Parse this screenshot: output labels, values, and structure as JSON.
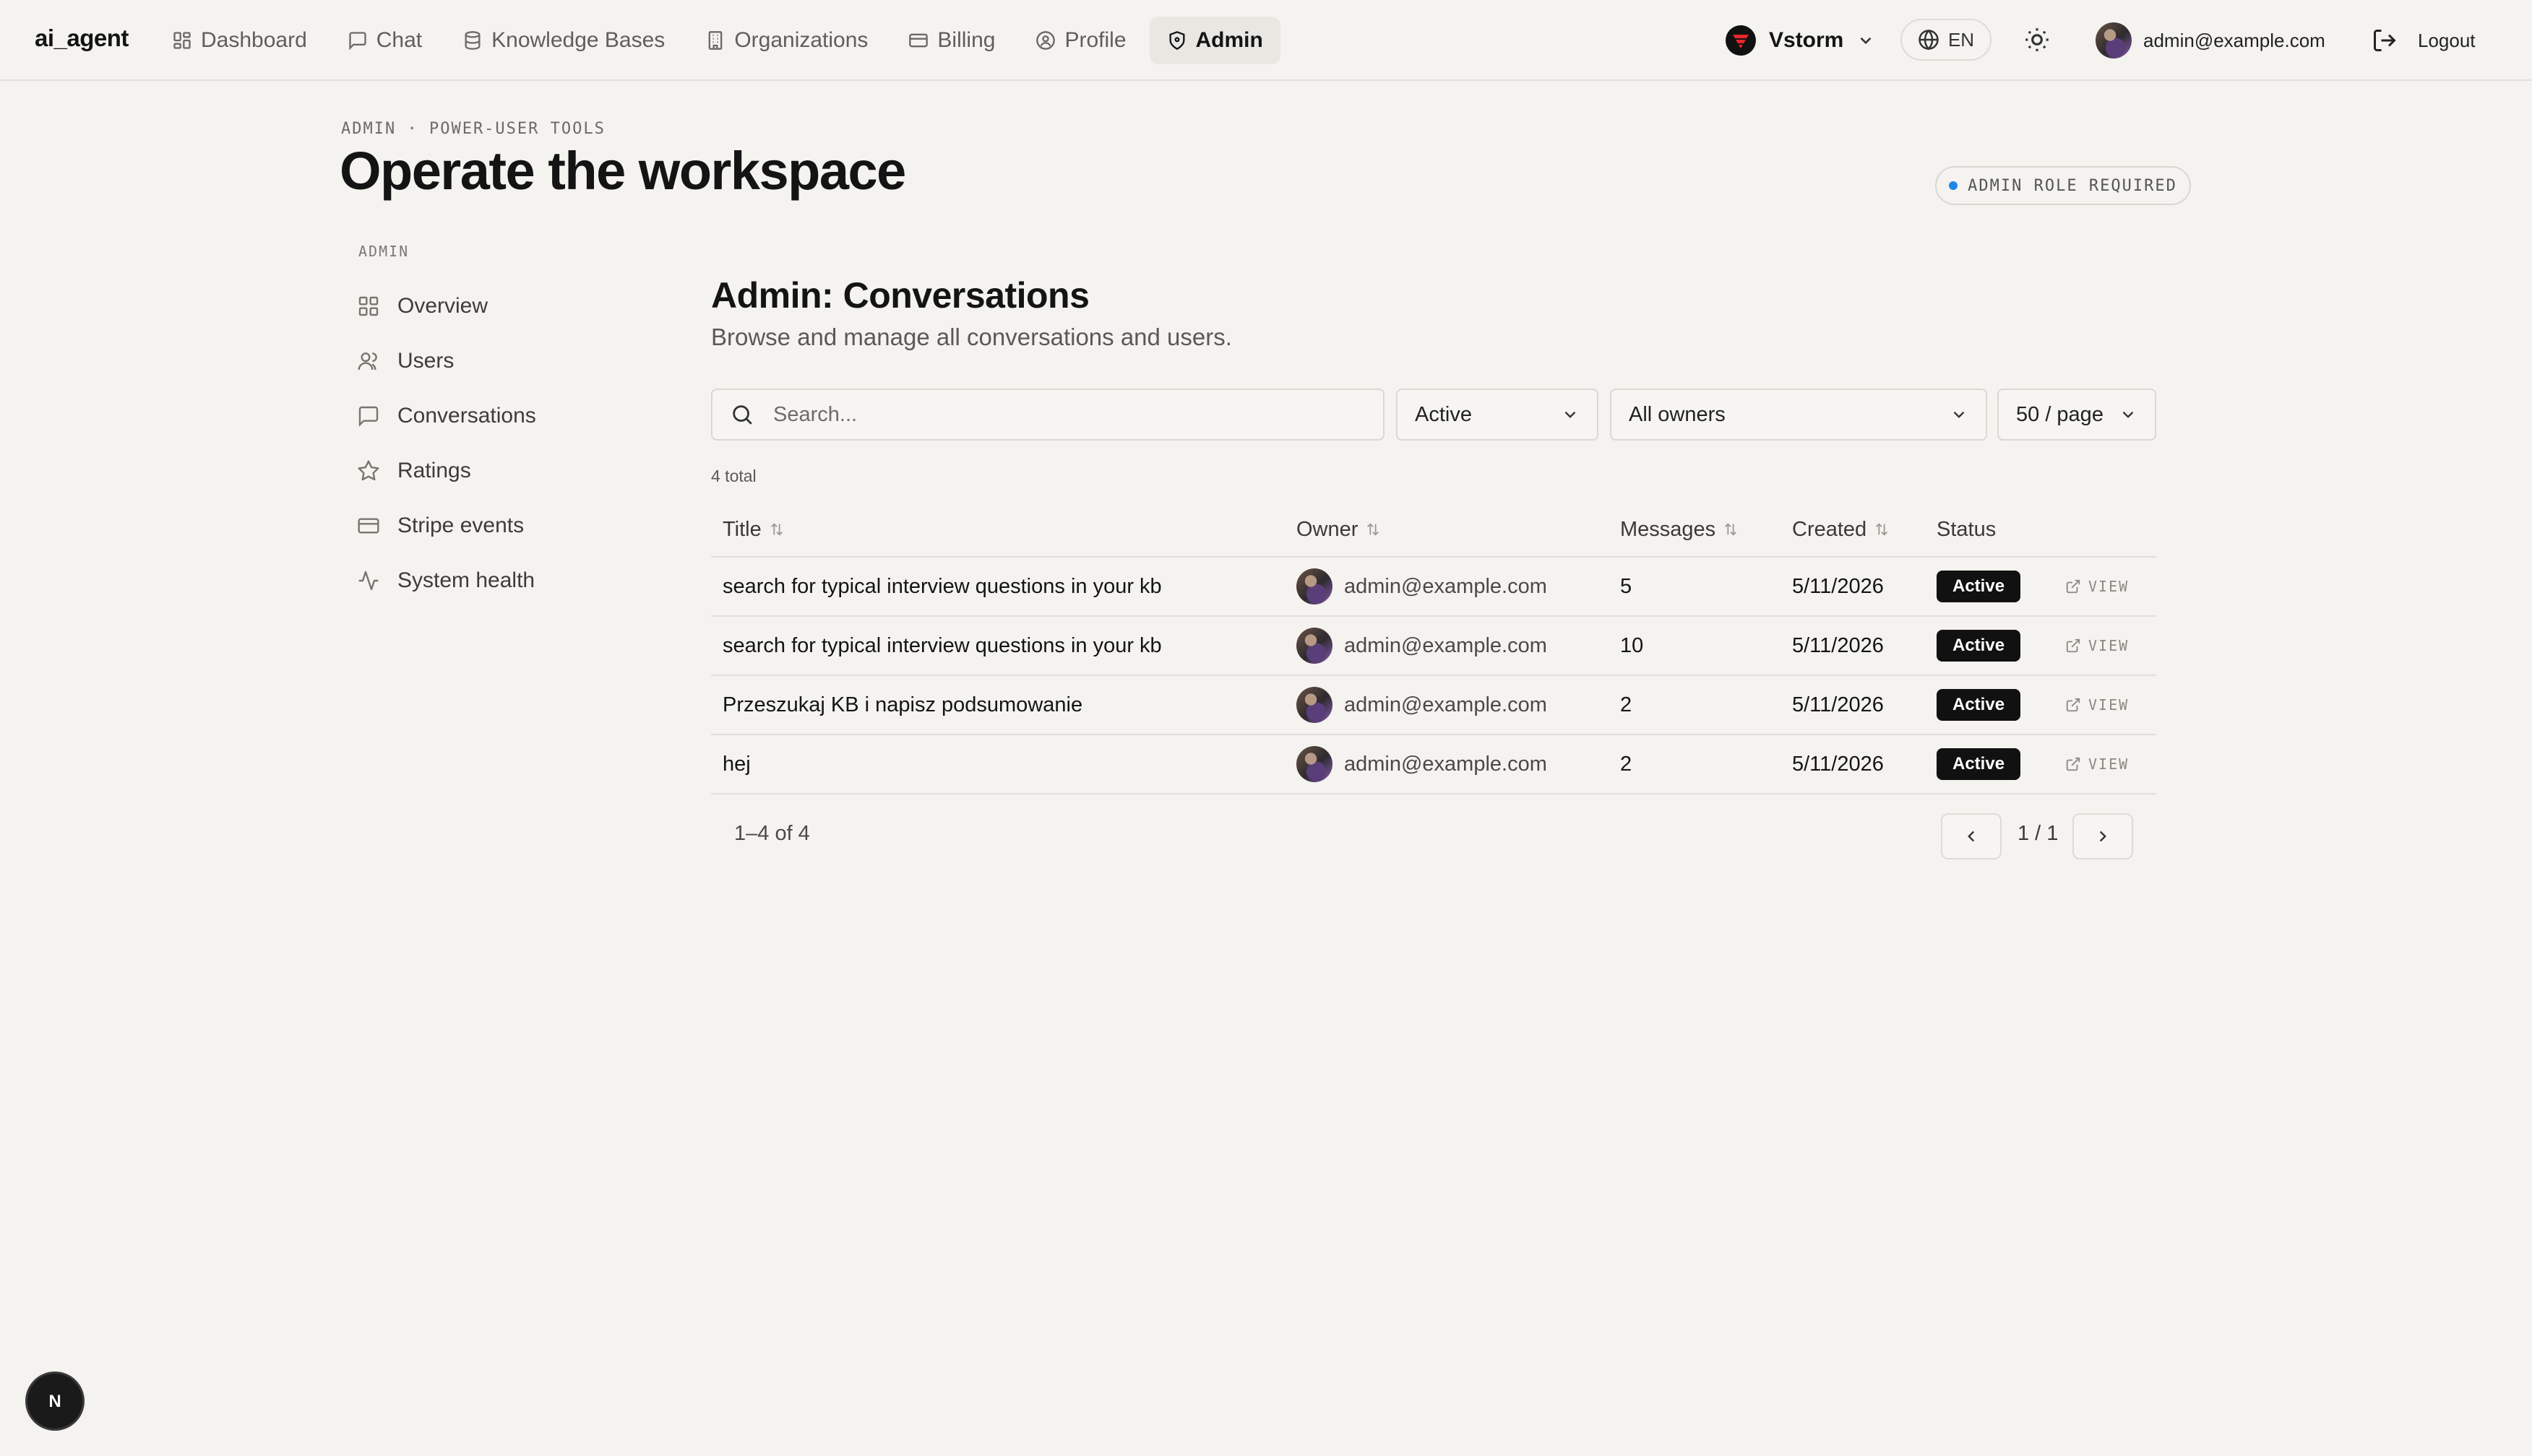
{
  "app": {
    "brand": "ai_agent"
  },
  "nav": [
    {
      "label": "Dashboard",
      "icon": "grid-icon"
    },
    {
      "label": "Chat",
      "icon": "chat-icon"
    },
    {
      "label": "Knowledge Bases",
      "icon": "database-icon"
    },
    {
      "label": "Organizations",
      "icon": "building-icon"
    },
    {
      "label": "Billing",
      "icon": "card-icon"
    },
    {
      "label": "Profile",
      "icon": "user-circle-icon"
    },
    {
      "label": "Admin",
      "icon": "shield-icon",
      "active": true
    }
  ],
  "org": {
    "name": "Vstorm",
    "logo_color": "#e8262d"
  },
  "lang": {
    "code": "EN"
  },
  "user": {
    "email": "admin@example.com"
  },
  "logout": {
    "label": "Logout"
  },
  "header": {
    "eyebrow": "ADMIN · POWER-USER TOOLS",
    "title": "Operate the workspace",
    "role_badge": "ADMIN ROLE REQUIRED",
    "role_dot_color": "#1f87e8"
  },
  "sidebar": {
    "label": "ADMIN",
    "items": [
      {
        "label": "Overview",
        "icon": "dashboard-icon"
      },
      {
        "label": "Users",
        "icon": "users-icon"
      },
      {
        "label": "Conversations",
        "icon": "chat-icon"
      },
      {
        "label": "Ratings",
        "icon": "star-icon"
      },
      {
        "label": "Stripe events",
        "icon": "card-icon"
      },
      {
        "label": "System health",
        "icon": "activity-icon"
      }
    ]
  },
  "main": {
    "title": "Admin: Conversations",
    "subtitle": "Browse and manage all conversations and users.",
    "search": {
      "placeholder": "Search...",
      "value": ""
    },
    "filters": {
      "status": "Active",
      "owner": "All owners",
      "page_size": "50 / page"
    },
    "total": "4 total",
    "columns": {
      "title": "Title",
      "owner": "Owner",
      "messages": "Messages",
      "created": "Created",
      "status": "Status"
    },
    "rows": [
      {
        "title": "search for typical interview questions in your kb",
        "owner": "admin@example.com",
        "messages": "5",
        "created": "5/11/2026",
        "status": "Active",
        "action": "VIEW"
      },
      {
        "title": "search for typical interview questions in your kb",
        "owner": "admin@example.com",
        "messages": "10",
        "created": "5/11/2026",
        "status": "Active",
        "action": "VIEW"
      },
      {
        "title": "Przeszukaj KB i napisz podsumowanie",
        "owner": "admin@example.com",
        "messages": "2",
        "created": "5/11/2026",
        "status": "Active",
        "action": "VIEW"
      },
      {
        "title": "hej",
        "owner": "admin@example.com",
        "messages": "2",
        "created": "5/11/2026",
        "status": "Active",
        "action": "VIEW"
      }
    ],
    "pagination": {
      "range": "1–4 of 4",
      "page": "1 / 1"
    }
  },
  "fab": {
    "letter": "N"
  }
}
